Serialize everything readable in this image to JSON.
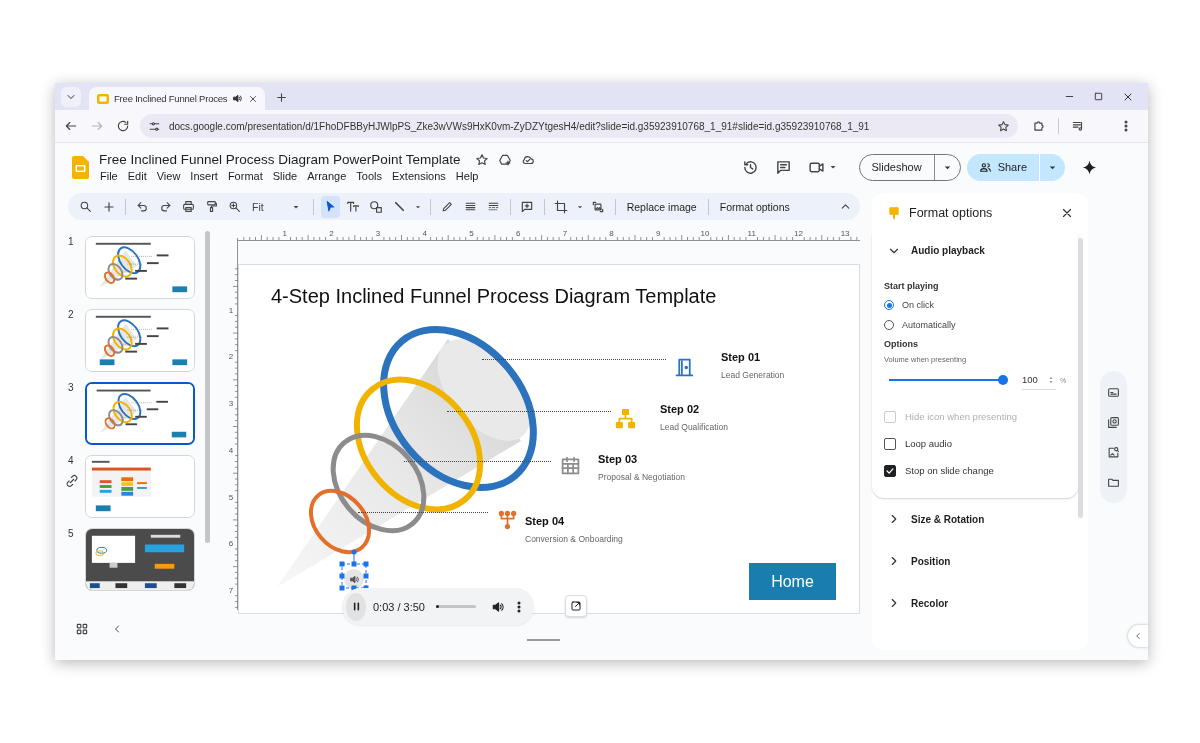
{
  "browser": {
    "tabs": [
      {
        "title": "Free Inclined Funnel Proces",
        "selected": true,
        "audio": true
      }
    ],
    "url": "docs.google.com/presentation/d/1FhoDFBByHJWlpPS_Zke3wVWs9HxK0vm-ZyDZYtgesH4/edit?slide=id.g35923910768_1_91#slide=id.g35923910768_1_91",
    "forward_enabled": false
  },
  "document": {
    "title": "Free Inclined Funnel Process Diagram PowerPoint Template",
    "menu": [
      "File",
      "Edit",
      "View",
      "Insert",
      "Format",
      "Slide",
      "Arrange",
      "Tools",
      "Extensions",
      "Help"
    ]
  },
  "actions": {
    "slideshow": "Slideshow",
    "share": "Share"
  },
  "toolbar": {
    "zoom": "Fit",
    "select_active": true,
    "buttons": [
      "Replace image",
      "Format options"
    ]
  },
  "filmstrip": {
    "slides": [
      {
        "number": "1",
        "kind": "funnel",
        "selected": false
      },
      {
        "number": "2",
        "kind": "funnel-back",
        "selected": false
      },
      {
        "number": "3",
        "kind": "funnel",
        "selected": true
      },
      {
        "number": "4",
        "kind": "layers",
        "selected": false
      },
      {
        "number": "5",
        "kind": "promo",
        "selected": false
      }
    ]
  },
  "rulers": {
    "horizontal": [
      "1",
      "2",
      "3",
      "4",
      "5",
      "6",
      "7",
      "8",
      "9",
      "10",
      "11",
      "12",
      "13"
    ],
    "vertical": [
      "1",
      "2",
      "3",
      "4",
      "5",
      "6",
      "7"
    ]
  },
  "slide": {
    "title": "4-Step Inclined Funnel Process Diagram Template",
    "steps": [
      {
        "title": "Step 01",
        "subtitle": "Lead Generation",
        "color": "#2b73bd"
      },
      {
        "title": "Step 02",
        "subtitle": "Lead Qualification",
        "color": "#f0b400"
      },
      {
        "title": "Step 03",
        "subtitle": "Proposal & Negotiation",
        "color": "#8c8c8c"
      },
      {
        "title": "Step 04",
        "subtitle": "Conversion & Onboarding",
        "color": "#e2702a"
      }
    ],
    "button": "Home"
  },
  "player": {
    "time": "0:03 / 3:50",
    "level": 0.013
  },
  "format_panel": {
    "title": "Format options",
    "sections": [
      {
        "title": "Audio playback",
        "expanded": true
      },
      {
        "title": "Size & Rotation",
        "expanded": false
      },
      {
        "title": "Position",
        "expanded": false
      },
      {
        "title": "Recolor",
        "expanded": false
      }
    ],
    "audio": {
      "start_label": "Start playing",
      "start_options": [
        {
          "label": "On click",
          "selected": true
        },
        {
          "label": "Automatically",
          "selected": false
        }
      ],
      "options_label": "Options",
      "volume_label": "Volume when presenting",
      "volume": {
        "level": 1,
        "value": "100",
        "unit": "%"
      },
      "checkboxes": [
        {
          "label": "Hide icon when presenting",
          "checked": false,
          "disabled": true
        },
        {
          "label": "Loop audio",
          "checked": false,
          "disabled": false
        },
        {
          "label": "Stop on slide change",
          "checked": true,
          "disabled": false
        }
      ]
    }
  }
}
